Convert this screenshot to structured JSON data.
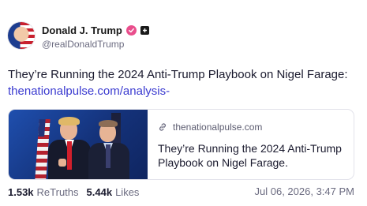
{
  "author": {
    "display_name": "Donald J. Trump",
    "handle": "@realDonaldTrump",
    "verified_icon": "verified-badge-icon",
    "badge_icon": "truth-social-badge-icon",
    "verified_color": "#e94e8c"
  },
  "post": {
    "text": "They’re Running the 2024 Anti-Trump Playbook on Nigel Farage:",
    "link_text": "thenationalpulse.com/analysis-",
    "link_color": "#3b3bd0"
  },
  "link_card": {
    "domain": "thenationalpulse.com",
    "domain_icon": "link-icon",
    "title": "They’re Running the 2024 Anti-Trump Playbook on Nigel Farage."
  },
  "stats": {
    "retruths_count": "1.53k",
    "retruths_label": "ReTruths",
    "likes_count": "5.44k",
    "likes_label": "Likes"
  },
  "timestamp": "Jul 06, 2026, 3:47 PM"
}
